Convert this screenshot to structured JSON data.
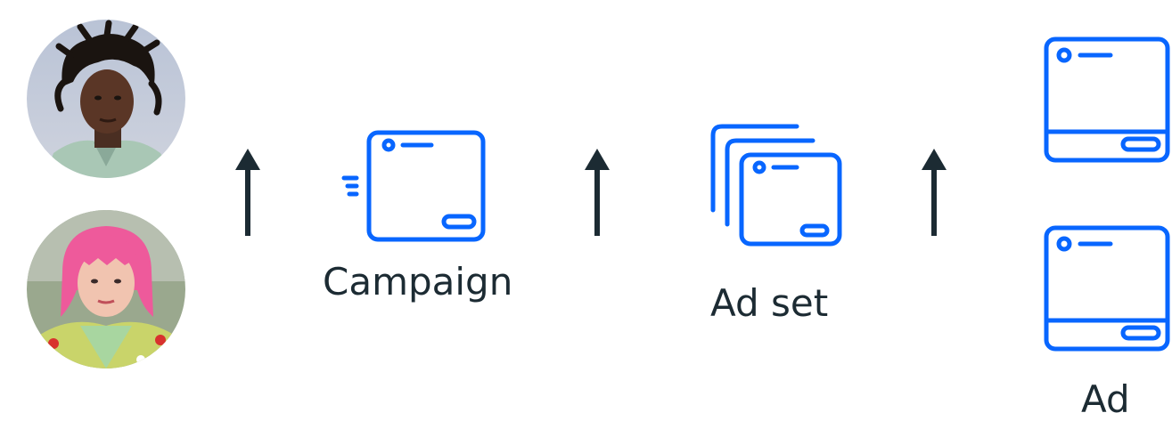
{
  "labels": {
    "campaign": "Campaign",
    "ad_set": "Ad set",
    "ad": "Ad"
  },
  "people": [
    {
      "name": "person-man-avatar"
    },
    {
      "name": "person-woman-pink-hair-avatar"
    }
  ],
  "colors": {
    "accent": "#0866ff",
    "arrow": "#1c2b33",
    "text": "#1c2b33"
  }
}
